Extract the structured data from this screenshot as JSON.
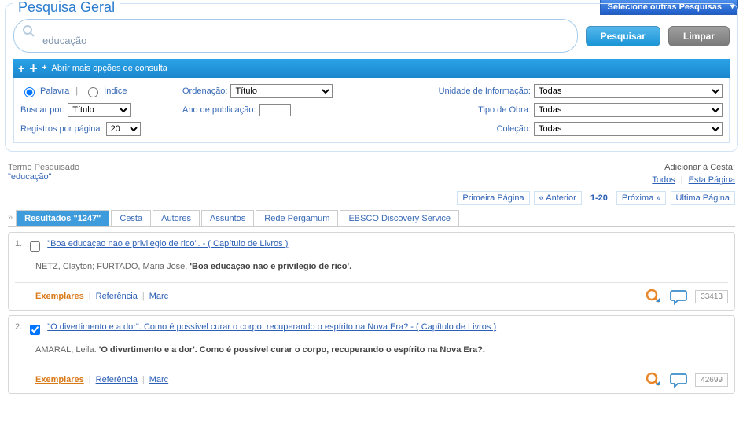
{
  "header": {
    "selector_label": "Selecione outras Pesquisas",
    "panel_title": "Pesquisa Geral"
  },
  "search": {
    "value": "educação",
    "btn_search": "Pesquisar",
    "btn_clear": "Limpar"
  },
  "options": {
    "bar_label": "Abrir mais opções de consulta",
    "radio_word": "Palavra",
    "radio_index": "Índice",
    "sort_label": "Ordenação:",
    "sort_value": "Título",
    "unit_label": "Unidade de Informação:",
    "unit_value": "Todas",
    "searchby_label": "Buscar por:",
    "searchby_value": "Título",
    "year_label": "Ano de publicação:",
    "type_label": "Tipo de Obra:",
    "type_value": "Todas",
    "perpage_label": "Registros por página:",
    "perpage_value": "20",
    "collection_label": "Coleção:",
    "collection_value": "Todas"
  },
  "meta": {
    "term_label": "Termo Pesquisado",
    "term_value": "\"educação\"",
    "basket_title": "Adicionar à Cesta:",
    "basket_all": "Todos",
    "basket_page": "Esta Página"
  },
  "paging": {
    "first": "Primeira Página",
    "prev": "« Anterior",
    "range": "1-20",
    "next": "Próxima »",
    "last": "Última Página"
  },
  "tabs": {
    "results": "Resultados \"1247\"",
    "cesta": "Cesta",
    "autores": "Autores",
    "assuntos": "Assuntos",
    "rede": "Rede Pergamum",
    "ebsco": "EBSCO Discovery Service"
  },
  "results": [
    {
      "num": "1.",
      "checked": false,
      "title": "\"Boa educaçao nao e privilegio de rico\". - ( Capítulo de Livros )",
      "authors_prefix": "NETZ, Clayton; FURTADO, Maria Jose. ",
      "authors_bold": "'Boa educaçao nao e privilegio de rico'.",
      "id": "33413"
    },
    {
      "num": "2.",
      "checked": true,
      "title": "\"O divertimento e a dor\". Como é possível curar o corpo, recuperando o espírito na Nova Era? - ( Capítulo de Livros )",
      "authors_prefix": "AMARAL, Leila. ",
      "authors_bold": "'O divertimento e a dor'. Como é possível curar o corpo, recuperando o espírito na Nova Era?.",
      "id": "42699"
    }
  ],
  "result_links": {
    "exemplares": "Exemplares",
    "referencia": "Referência",
    "marc": "Marc"
  }
}
